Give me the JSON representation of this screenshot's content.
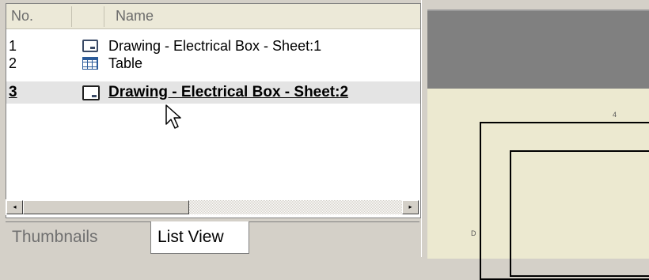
{
  "list": {
    "columns": {
      "no": "No.",
      "icon": "",
      "name": "Name"
    },
    "rows": [
      {
        "no": "1",
        "icon": "drawing-icon",
        "name": "Drawing - Electrical Box - Sheet:1",
        "selected": false
      },
      {
        "no": "2",
        "icon": "table-icon",
        "name": "Table",
        "selected": false
      },
      {
        "no": "3",
        "icon": "drawing-icon",
        "name": "Drawing - Electrical Box - Sheet:2",
        "selected": true
      }
    ]
  },
  "scrollbar": {
    "left_arrow": "◂",
    "right_arrow": "▸"
  },
  "tabs": {
    "thumbnails": "Thumbnails",
    "list_view": "List View",
    "active": "List View"
  },
  "drawing": {
    "zone_top": "4",
    "zone_left": "D"
  },
  "colors": {
    "sheet_background": "#ece9d0",
    "canvas_background": "#808080",
    "selected_row": "#e4e4e4"
  }
}
